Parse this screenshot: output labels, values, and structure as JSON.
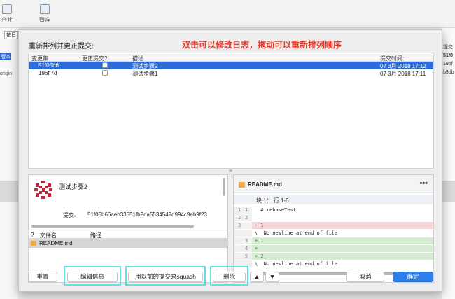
{
  "background": {
    "toolbar": [
      {
        "label": "合并"
      },
      {
        "label": "暂存"
      }
    ],
    "left_chips": [
      "按日",
      "版本",
      "origin"
    ],
    "right_chips": [
      "提交",
      "51f0",
      "196f",
      "b9db"
    ]
  },
  "dialog": {
    "title": "重新排列并更正提交:",
    "annotation": "双击可以修改日志，拖动可以重新排列顺序",
    "table": {
      "headers": {
        "changeset": "变更集",
        "amend": "更正提交?",
        "description": "描述",
        "time": "提交时间:"
      },
      "rows": [
        {
          "hash": "51f05b6",
          "desc": "测试步骤2",
          "time": "07 3月 2018 17:12",
          "selected": true
        },
        {
          "hash": "196ff7d",
          "desc": "测试步骤1",
          "time": "07 3月 2018 17:11",
          "selected": false
        }
      ]
    },
    "detail": {
      "subject": "测试步骤2",
      "commit_label": "提交:",
      "commit_hash": "51f05b66aeb33551fb2da5534549d994c9ab9f23"
    },
    "files": {
      "headers": {
        "q": "?",
        "name": "文件名",
        "path": "路径"
      },
      "rows": [
        {
          "name": "README.md"
        }
      ]
    },
    "diff": {
      "file": "README.md",
      "more": "•••",
      "hunk": "块 1： 行 1-5",
      "lines": [
        {
          "n1": "1",
          "n2": "1",
          "code": "  # rebaseTest",
          "type": "ctx"
        },
        {
          "n1": "2",
          "n2": "2",
          "code": "",
          "type": "ctx"
        },
        {
          "n1": "3",
          "n2": "",
          "code": "- 1",
          "type": "del"
        },
        {
          "n1": "",
          "n2": "",
          "code": "\\  No newline at end of file",
          "type": "ctx"
        },
        {
          "n1": "",
          "n2": "3",
          "code": "+ 1",
          "type": "add"
        },
        {
          "n1": "",
          "n2": "4",
          "code": "+",
          "type": "add"
        },
        {
          "n1": "",
          "n2": "5",
          "code": "+ 2",
          "type": "add"
        },
        {
          "n1": "",
          "n2": "",
          "code": "\\  No newline at end of file",
          "type": "ctx"
        }
      ]
    },
    "buttons": {
      "reset": "重置",
      "edit": "编辑信息",
      "squash": "用以前的提交来squash",
      "delete": "删除",
      "up": "▲",
      "down": "▼",
      "cancel": "取消",
      "ok": "确定"
    }
  }
}
